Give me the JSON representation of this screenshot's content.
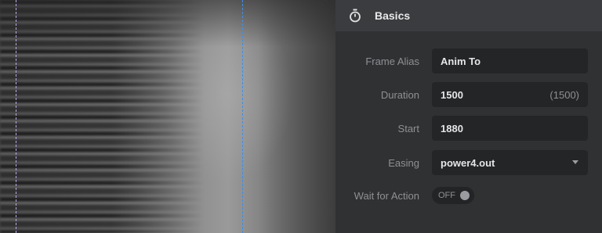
{
  "panel": {
    "title": "Basics",
    "icon": "stopwatch-icon",
    "fields": {
      "frame_alias": {
        "label": "Frame Alias",
        "value": "Anim To"
      },
      "duration": {
        "label": "Duration",
        "value": "1500",
        "hint": "(1500)"
      },
      "start": {
        "label": "Start",
        "value": "1880"
      },
      "easing": {
        "label": "Easing",
        "value": "power4.out"
      },
      "wait_for_action": {
        "label": "Wait for Action",
        "state": "OFF"
      }
    }
  },
  "canvas": {
    "guide_colors": {
      "left": "#b9a6e6",
      "right": "#3d8fe8"
    }
  }
}
